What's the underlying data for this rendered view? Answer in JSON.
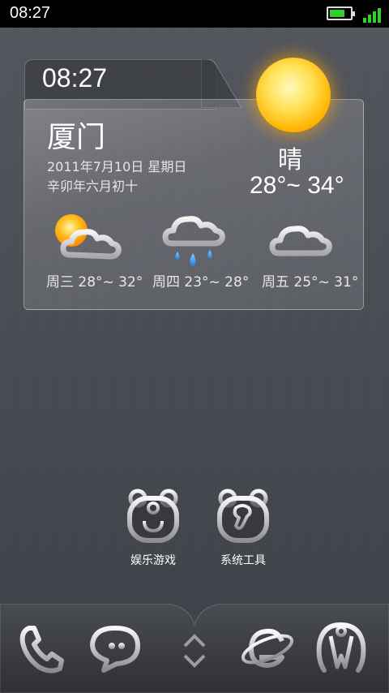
{
  "status_bar": {
    "time": "08:27",
    "battery_level": 0.75,
    "signal_bars": 4,
    "accent": "#2fd02f"
  },
  "widget": {
    "clock": "08:27",
    "city": "厦门",
    "date": "2011年7月10日  星期日",
    "lunar": "辛卯年六月初十",
    "condition": "晴",
    "range": "28°~ 34°",
    "forecast": [
      {
        "label": "周三 28°~ 32°",
        "icon": "sun-cloud-icon"
      },
      {
        "label": "周四 23°~ 28°",
        "icon": "rain-cloud-icon"
      },
      {
        "label": "周五 25°~ 31°",
        "icon": "cloud-icon"
      }
    ]
  },
  "apps": [
    {
      "label": "娱乐游戏",
      "icon": "joystick-bear-icon"
    },
    {
      "label": "系统工具",
      "icon": "wrench-bear-icon"
    }
  ],
  "dock": {
    "icons": [
      "phone-icon",
      "messages-icon",
      "app-drawer-icon",
      "browser-icon",
      "contacts-icon"
    ]
  }
}
